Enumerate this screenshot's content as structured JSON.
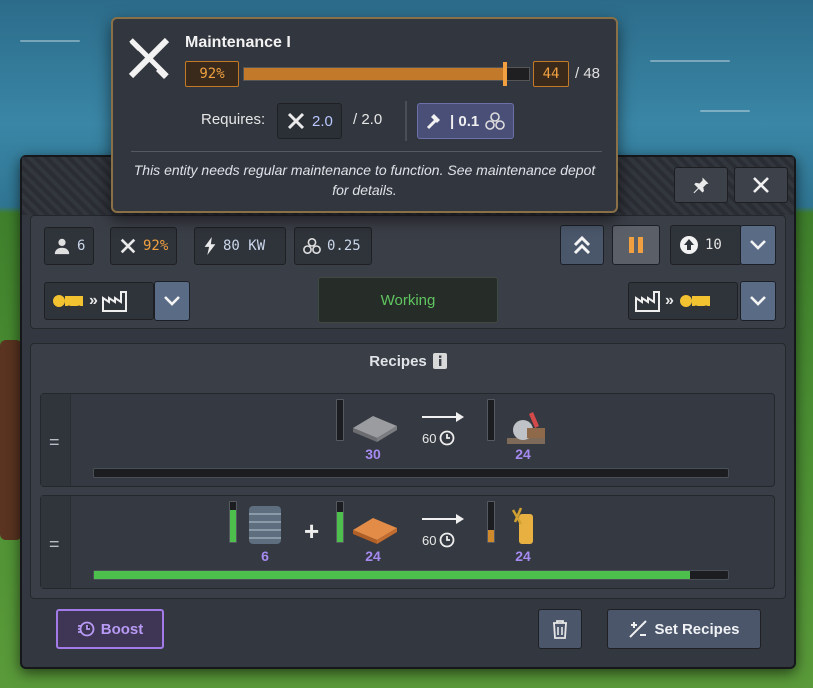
{
  "tooltip": {
    "title": "Maintenance I",
    "percent": "92%",
    "fill_fraction": 0.92,
    "current": "44",
    "max": "/ 48",
    "requires_label": "Requires:",
    "req_value": "2.0",
    "req_total": "/ 2.0",
    "req_cost": "| 0.1",
    "description": "This entity needs regular maintenance to function. See maintenance depot for details."
  },
  "stats": {
    "workers": "6",
    "maintenance": "92%",
    "power": "80 KW",
    "unity": "0.25"
  },
  "priority": "10",
  "status": "Working",
  "recipes_title": "Recipes",
  "recipes": [
    {
      "inputs": [
        {
          "qty": "30",
          "icon": "concrete-slab-icon",
          "fill": 0
        }
      ],
      "time": "60",
      "outputs": [
        {
          "qty": "24",
          "icon": "sawmill-product-icon",
          "fill": 0
        }
      ],
      "progress": 0
    },
    {
      "inputs": [
        {
          "qty": "6",
          "icon": "rubber-roll-icon",
          "fill": 0.8
        },
        {
          "qty": "24",
          "icon": "wood-plank-icon",
          "fill": 0.75
        }
      ],
      "time": "60",
      "outputs": [
        {
          "qty": "24",
          "icon": "paper-roll-icon",
          "fill": 0.3
        }
      ],
      "progress": 0.94
    }
  ],
  "footer": {
    "boost": "Boost",
    "set_recipes": "Set Recipes"
  },
  "colors": {
    "accent_orange": "#f0a040",
    "status_green": "#5fc55f",
    "quantity_purple": "#a58af0",
    "boost_purple": "#a27be8"
  }
}
